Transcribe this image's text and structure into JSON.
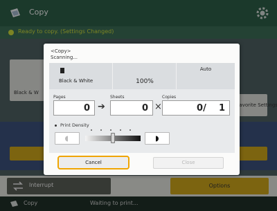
{
  "app": {
    "title": "Copy",
    "icon": "copy-app-icon",
    "settings_icon": "gear-icon"
  },
  "status": {
    "message": "Ready to copy. (Settings Changed)",
    "color": "#c8d63a"
  },
  "background": {
    "bw_label": "Black & W",
    "right_tile_label": "Favorite Settings",
    "interrupt_label": "Interrupt",
    "options_label": "Options"
  },
  "footer": {
    "app_label": "Copy",
    "status_text": "Waiting to print..."
  },
  "dialog": {
    "heading": "<Copy>",
    "subheading": "Scanning...",
    "color_mode": "Black & White",
    "ratio": "100%",
    "paper": "Auto",
    "pages_label": "Pages",
    "pages_value": "0",
    "sheets_label": "Sheets",
    "sheets_value": "0",
    "copies_label": "Copies",
    "copies_value": "0/    1",
    "density_label": "Print Density",
    "density_level_fraction": 0.5,
    "cancel_label": "Cancel",
    "close_label": "Close",
    "accent_color": "#f0a500"
  }
}
